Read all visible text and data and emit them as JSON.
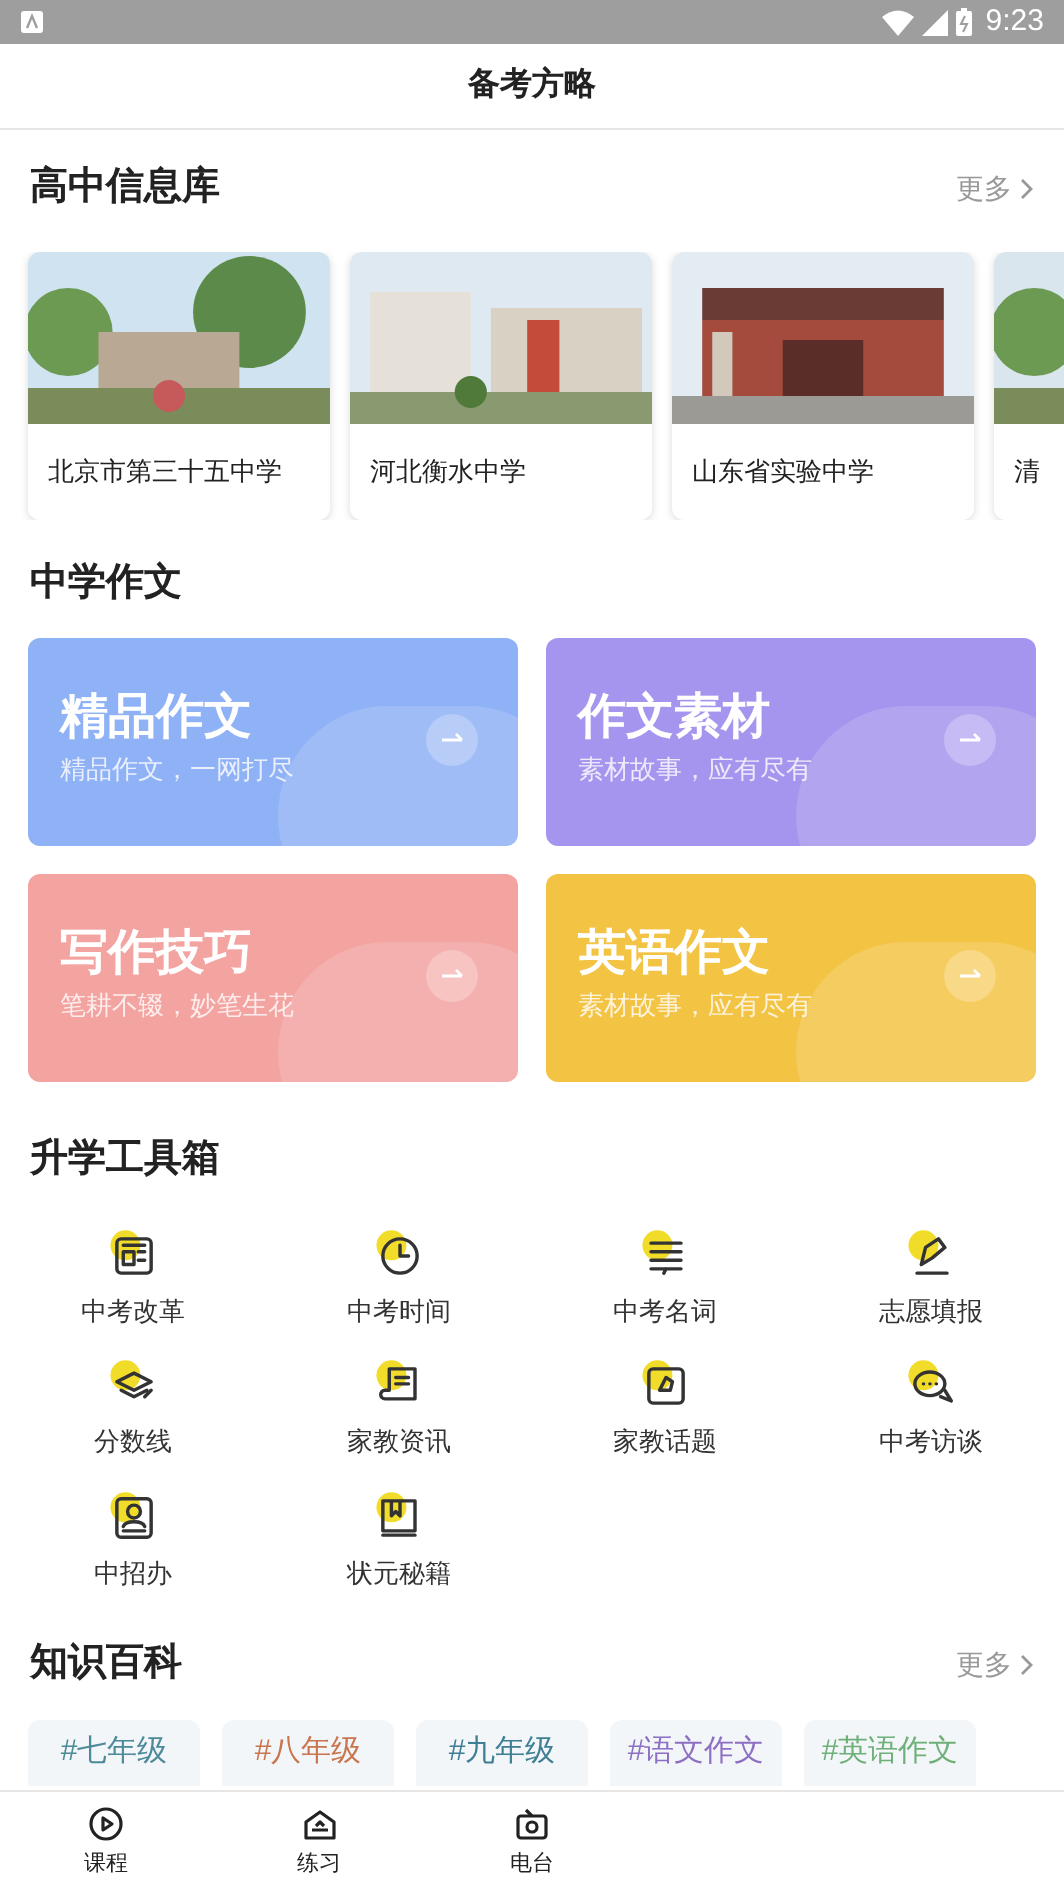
{
  "status_bar": {
    "time": "9:23"
  },
  "header": {
    "title": "备考方略"
  },
  "schools": {
    "title": "高中信息库",
    "more": "更多",
    "items": [
      {
        "name": "北京市第三十五中学",
        "kind": "picture"
      },
      {
        "name": "河北衡水中学",
        "kind": "picture"
      },
      {
        "name": "山东省实验中学",
        "kind": "picture"
      },
      {
        "name": "清",
        "kind": "picture"
      }
    ]
  },
  "composition": {
    "title": "中学作文",
    "cards": [
      {
        "title": "精品作文",
        "subtitle": "精品作文，一网打尽",
        "color": "#8fb1f5"
      },
      {
        "title": "作文素材",
        "subtitle": "素材故事，应有尽有",
        "color": "#a695ee"
      },
      {
        "title": "写作技巧",
        "subtitle": "笔耕不辍，妙笔生花",
        "color": "#f3a3a0"
      },
      {
        "title": "英语作文",
        "subtitle": "素材故事，应有尽有",
        "color": "#f3c344"
      }
    ]
  },
  "tools": {
    "title": "升学工具箱",
    "items": [
      {
        "label": "中考改革",
        "kind": "news"
      },
      {
        "label": "中考时间",
        "kind": "clock"
      },
      {
        "label": "中考名词",
        "kind": "books"
      },
      {
        "label": "志愿填报",
        "kind": "pencil"
      },
      {
        "label": "分数线",
        "kind": "cap"
      },
      {
        "label": "家教资讯",
        "kind": "scroll"
      },
      {
        "label": "家教话题",
        "kind": "puzzle"
      },
      {
        "label": "中考访谈",
        "kind": "chat"
      },
      {
        "label": "中招办",
        "kind": "person"
      },
      {
        "label": "状元秘籍",
        "kind": "book"
      }
    ]
  },
  "knowledge": {
    "title": "知识百科",
    "more": "更多",
    "tags": [
      {
        "label": "#七年级",
        "color": "#4c8a9a"
      },
      {
        "label": "#八年级",
        "color": "#c9754f"
      },
      {
        "label": "#九年级",
        "color": "#3f7f95"
      },
      {
        "label": "#语文作文",
        "color": "#8d6fc4"
      },
      {
        "label": "#英语作文",
        "color": "#6fb07a"
      }
    ]
  },
  "tab_bar": [
    {
      "label": "课程",
      "kind": "play"
    },
    {
      "label": "练习",
      "kind": "house"
    },
    {
      "label": "电台",
      "kind": "radio"
    }
  ]
}
